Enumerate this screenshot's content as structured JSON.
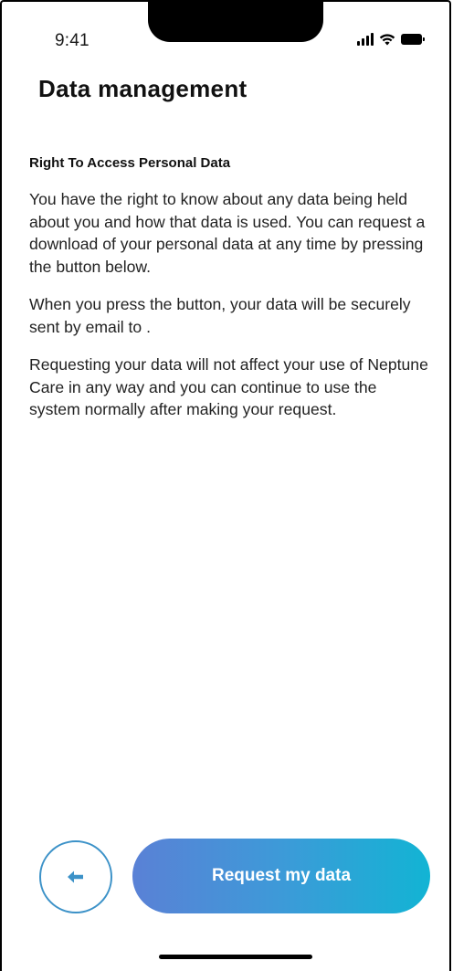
{
  "status_bar": {
    "time": "9:41"
  },
  "header": {
    "title": "Data management"
  },
  "content": {
    "section_heading": "Right To Access Personal Data",
    "paragraphs": [
      "You have the right to know about any data being held about you and how that data is used. You can request a download of your personal data at any time by pressing the button below.",
      "When you press the button, your data will be securely sent by email to .",
      "Requesting your data will not affect your use of Neptune Care in any way and you can continue to use the system normally after making your request."
    ]
  },
  "footer": {
    "back_icon": "arrow-left-icon",
    "request_label": "Request my data"
  },
  "colors": {
    "back_border": "#3c92c8",
    "button_gradient_start": "#5a81d6",
    "button_gradient_end": "#12b4d4"
  }
}
